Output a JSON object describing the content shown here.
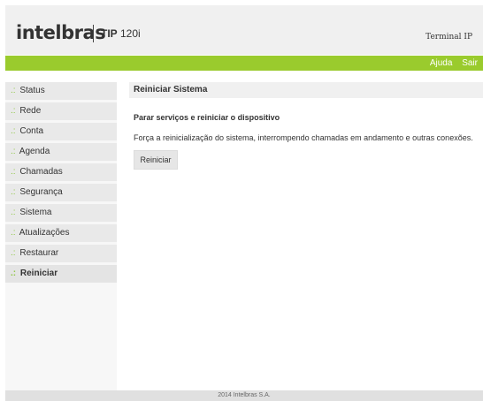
{
  "header": {
    "logo": "intelbras",
    "model_prefix": "TIP",
    "model_suffix": " 120i",
    "terminal_label": "Terminal IP"
  },
  "topbar": {
    "help_link": "Ajuda",
    "logout_link": "Sair"
  },
  "sidebar": {
    "items": [
      {
        "label": "Status"
      },
      {
        "label": "Rede"
      },
      {
        "label": "Conta"
      },
      {
        "label": "Agenda"
      },
      {
        "label": "Chamadas"
      },
      {
        "label": "Segurança"
      },
      {
        "label": "Sistema"
      },
      {
        "label": "Atualizações"
      },
      {
        "label": "Restaurar"
      },
      {
        "label": "Reiniciar",
        "active": true
      }
    ]
  },
  "main": {
    "section_title": "Reiniciar Sistema",
    "subtitle": "Parar serviços e reiniciar o dispositivo",
    "description": "Força a reinicialização do sistema, interrompendo chamadas em andamento e outras conexões.",
    "restart_button": "Reiniciar"
  },
  "footer": {
    "copyright": "2014 Intelbras S.A."
  },
  "colors": {
    "accent_green": "#9acb2d",
    "menu_bullet": "#8dc63f"
  }
}
